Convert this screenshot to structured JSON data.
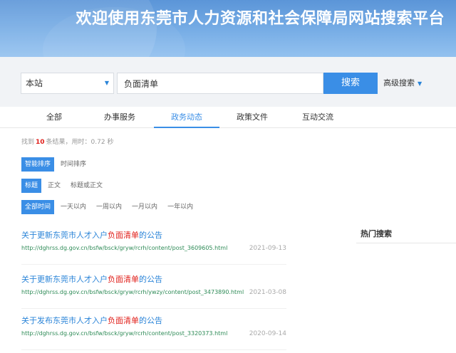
{
  "banner": {
    "title": "欢迎使用东莞市人力资源和社会保障局网站搜索平台"
  },
  "search": {
    "scope": "本站",
    "query": "负面清单",
    "button_label": "搜索",
    "advanced_label": "高级搜索"
  },
  "tabs": [
    {
      "label": "全部"
    },
    {
      "label": "办事服务"
    },
    {
      "label": "政务动态",
      "active": true
    },
    {
      "label": "政策文件"
    },
    {
      "label": "互动交流"
    }
  ],
  "summary": {
    "prefix": "找到",
    "count": "10",
    "suffix": "条结果，用时：0.72 秒"
  },
  "filters": {
    "sort": [
      "智能排序",
      "时间排序"
    ],
    "field": [
      "标题",
      "正文",
      "标题或正文"
    ],
    "time": [
      "全部时间",
      "一天以内",
      "一周以内",
      "一月以内",
      "一年以内"
    ]
  },
  "results": [
    {
      "title_pre": "关于更新东莞市人才入户",
      "title_hl": "负面清单",
      "title_post": "的公告",
      "url": "http://dghrss.dg.gov.cn/bsfw/bsck/gryw/rcrh/content/post_3609605.html",
      "date": "2021-09-13"
    },
    {
      "title_pre": "关于更新东莞市人才入户",
      "title_hl": "负面清单",
      "title_post": "的公告",
      "url": "http://dghrss.dg.gov.cn/bsfw/bsck/gryw/rcrh/ywzy/content/post_3473890.html",
      "date": "2021-03-08"
    },
    {
      "title_pre": "关于发布东莞市人才入户",
      "title_hl": "负面清单",
      "title_post": "的公告",
      "url": "http://dghrss.dg.gov.cn/bsfw/bsck/gryw/rcrh/content/post_3320373.html",
      "date": "2020-09-14"
    }
  ],
  "hot": {
    "title": "热门搜索"
  },
  "colors": {
    "accent": "#3a8ee6",
    "highlight": "#e0201b",
    "url": "#2e8b57",
    "banner": "#6aa4e0"
  }
}
